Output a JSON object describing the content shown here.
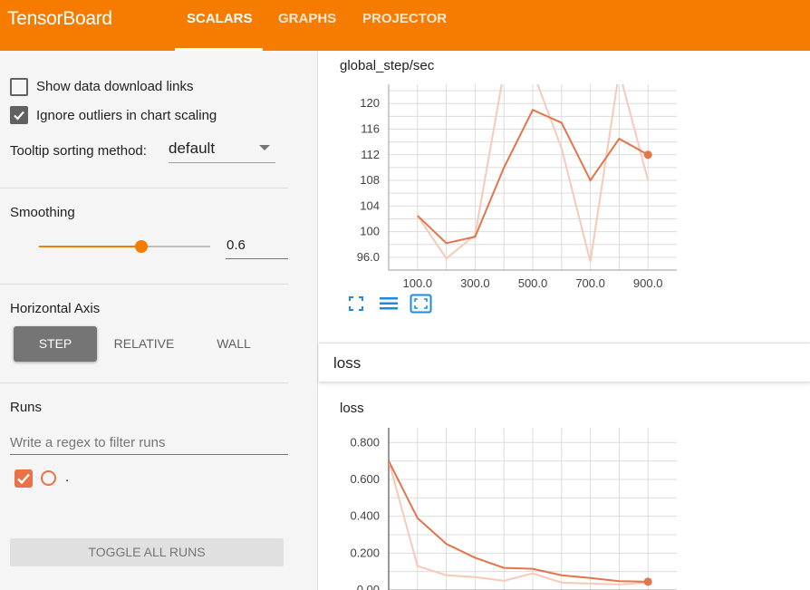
{
  "header": {
    "brand": "TensorBoard",
    "tabs": [
      {
        "label": "SCALARS",
        "active": true
      },
      {
        "label": "GRAPHS",
        "active": false
      },
      {
        "label": "PROJECTOR",
        "active": false
      }
    ],
    "color": "#f57c00"
  },
  "sidebar": {
    "show_download_links": {
      "label": "Show data download links",
      "checked": false
    },
    "ignore_outliers": {
      "label": "Ignore outliers in chart scaling",
      "checked": true
    },
    "tooltip_sorting": {
      "label": "Tooltip sorting method:",
      "value": "default"
    },
    "smoothing": {
      "label": "Smoothing",
      "value": "0.6",
      "fraction": 0.6
    },
    "horizontal_axis": {
      "label": "Horizontal Axis",
      "options": [
        "STEP",
        "RELATIVE",
        "WALL"
      ],
      "selected": "STEP"
    },
    "runs": {
      "label": "Runs",
      "filter_placeholder": "Write a regex to filter runs",
      "items": [
        {
          "name": ".",
          "checked": true,
          "color": "#ea7148"
        }
      ],
      "toggle_label": "TOGGLE ALL RUNS"
    }
  },
  "main": {
    "card1_title": "global_step/sec",
    "category_label": "loss",
    "card2_title": "loss",
    "tools": [
      "fit-domain-icon",
      "toggle-log-scale-icon",
      "expand-chart-icon"
    ]
  },
  "chart_data": [
    {
      "type": "line",
      "title": "global_step/sec",
      "x": [
        100,
        200,
        300,
        400,
        500,
        600,
        700,
        800,
        900
      ],
      "series": [
        {
          "smoothed": true,
          "color": "#e4744a",
          "values": [
            102.5,
            98.2,
            99.2,
            110,
            119,
            117,
            108,
            114.5,
            112
          ]
        },
        {
          "smoothed": false,
          "color": "#f8c9b8",
          "values": [
            102.5,
            95.8,
            99.5,
            125,
            125,
            113,
            95.3,
            125,
            108
          ]
        }
      ],
      "xticks": [
        "100.0",
        "300.0",
        "500.0",
        "700.0",
        "900.0"
      ],
      "yticks": [
        "96.0",
        "100",
        "104",
        "108",
        "112",
        "116",
        "120"
      ],
      "xlim": [
        0,
        1000
      ],
      "ylim": [
        94,
        123
      ],
      "grid": true
    },
    {
      "type": "line",
      "title": "loss",
      "x": [
        0,
        100,
        200,
        300,
        400,
        500,
        600,
        700,
        800,
        900
      ],
      "series": [
        {
          "smoothed": true,
          "color": "#e4744a",
          "values": [
            0.7,
            0.39,
            0.25,
            0.175,
            0.12,
            0.115,
            0.08,
            0.065,
            0.048,
            0.045
          ]
        },
        {
          "smoothed": false,
          "color": "#f8c9b8",
          "values": [
            0.7,
            0.13,
            0.08,
            0.07,
            0.05,
            0.09,
            0.04,
            0.035,
            0.03,
            0.04
          ]
        }
      ],
      "yticks": [
        "0.00",
        "0.200",
        "0.400",
        "0.600",
        "0.800"
      ],
      "xlim": [
        0,
        1000
      ],
      "ylim": [
        0,
        0.88
      ],
      "grid": true
    }
  ]
}
